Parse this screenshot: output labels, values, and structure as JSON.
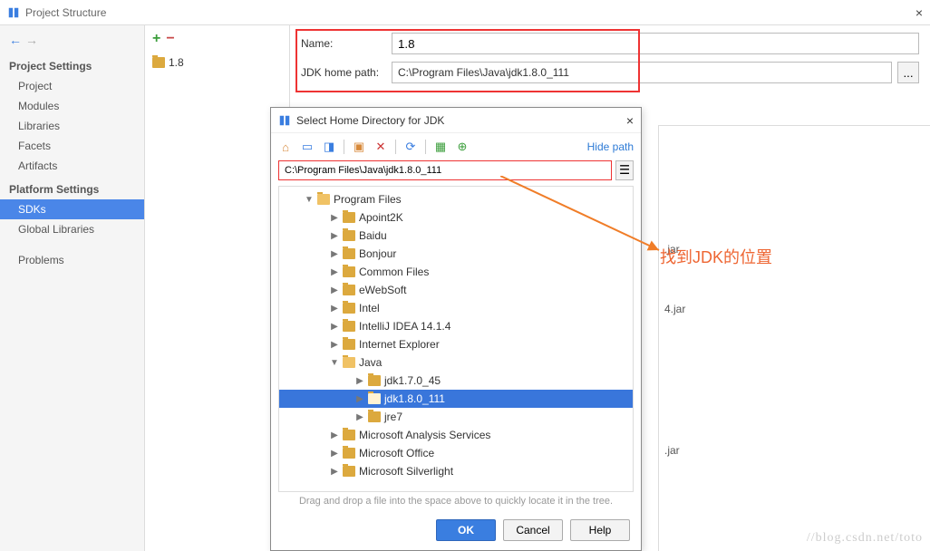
{
  "window": {
    "title": "Project Structure",
    "close_icon": "×"
  },
  "nav_arrows": {
    "back": "←",
    "forward": "→"
  },
  "sidebar": {
    "header1": "Project Settings",
    "items1": [
      "Project",
      "Modules",
      "Libraries",
      "Facets",
      "Artifacts"
    ],
    "header2": "Platform Settings",
    "items2": [
      "SDKs",
      "Global Libraries"
    ],
    "problems": "Problems"
  },
  "mid": {
    "selected": "1.8"
  },
  "form": {
    "name_label": "Name:",
    "name_value": "1.8",
    "path_label": "JDK home path:",
    "path_value": "C:\\Program Files\\Java\\jdk1.8.0_111",
    "ellipsis": "..."
  },
  "right_panel": {
    "line1": ".jar",
    "line2": "4.jar",
    "line3": ".jar"
  },
  "annotation": "找到JDK的位置",
  "dialog": {
    "title": "Select Home Directory for JDK",
    "hide_path": "Hide path",
    "path": "C:\\Program Files\\Java\\jdk1.8.0_111",
    "tree": [
      {
        "label": "Program Files",
        "indent": 28,
        "expanded": true
      },
      {
        "label": "Apoint2K",
        "indent": 56,
        "expanded": false
      },
      {
        "label": "Baidu",
        "indent": 56,
        "expanded": false
      },
      {
        "label": "Bonjour",
        "indent": 56,
        "expanded": false
      },
      {
        "label": "Common Files",
        "indent": 56,
        "expanded": false
      },
      {
        "label": "eWebSoft",
        "indent": 56,
        "expanded": false
      },
      {
        "label": "Intel",
        "indent": 56,
        "expanded": false
      },
      {
        "label": "IntelliJ IDEA 14.1.4",
        "indent": 56,
        "expanded": false
      },
      {
        "label": "Internet Explorer",
        "indent": 56,
        "expanded": false
      },
      {
        "label": "Java",
        "indent": 56,
        "expanded": true
      },
      {
        "label": "jdk1.7.0_45",
        "indent": 84,
        "expanded": false
      },
      {
        "label": "jdk1.8.0_111",
        "indent": 84,
        "expanded": false,
        "selected": true
      },
      {
        "label": "jre7",
        "indent": 84,
        "expanded": false
      },
      {
        "label": "Microsoft Analysis Services",
        "indent": 56,
        "expanded": false
      },
      {
        "label": "Microsoft Office",
        "indent": 56,
        "expanded": false
      },
      {
        "label": "Microsoft Silverlight",
        "indent": 56,
        "expanded": false
      }
    ],
    "hint": "Drag and drop a file into the space above to quickly locate it in the tree.",
    "ok": "OK",
    "cancel": "Cancel",
    "help": "Help"
  },
  "watermark": "//blog.csdn.net/toto"
}
